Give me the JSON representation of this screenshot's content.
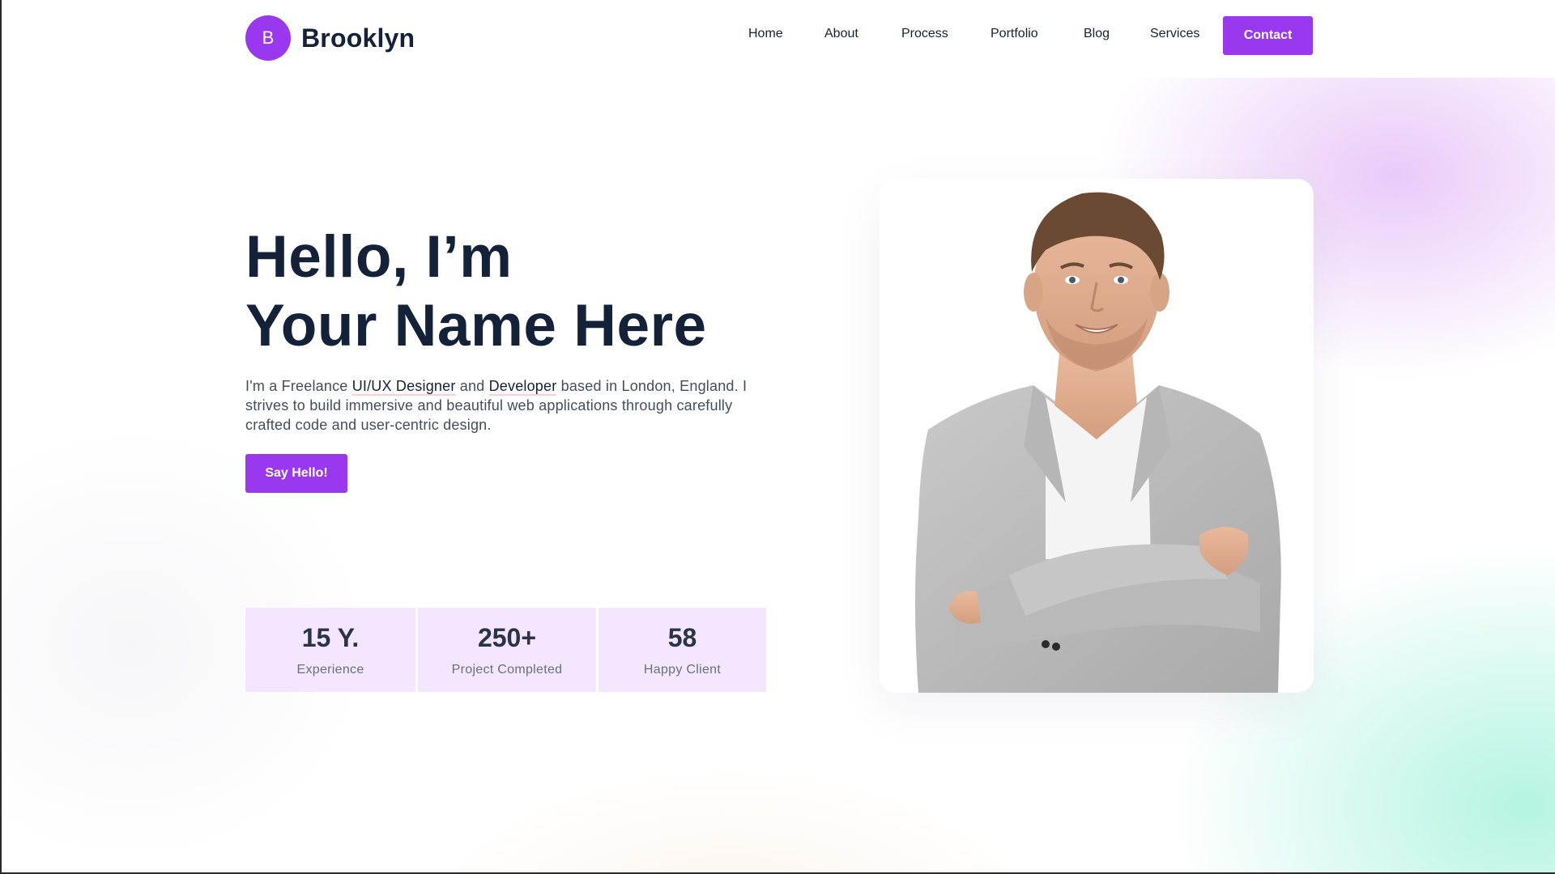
{
  "brand": {
    "logo_letter": "B",
    "name": "Brooklyn",
    "accent_color": "#9a38f0"
  },
  "nav": {
    "items": [
      "Home",
      "About",
      "Process",
      "Portfolio",
      "Blog",
      "Services"
    ],
    "contact_label": "Contact"
  },
  "hero": {
    "title_line1": "Hello, I’m",
    "title_line2": "Your Name Here",
    "desc_part1": "I'm a Freelance ",
    "desc_highlight1": "UI/UX Designer",
    "desc_part2": " and ",
    "desc_highlight2": "Developer",
    "desc_part3": " based in London, England. I strives to build immersive and beautiful web applications through carefully crafted code and user-centric design.",
    "cta_label": "Say Hello!"
  },
  "stats": [
    {
      "value": "15 Y.",
      "label": "Experience"
    },
    {
      "value": "250+",
      "label": "Project Completed"
    },
    {
      "value": "58",
      "label": "Happy Client"
    }
  ],
  "photo": {
    "icon": "portrait-photo"
  }
}
